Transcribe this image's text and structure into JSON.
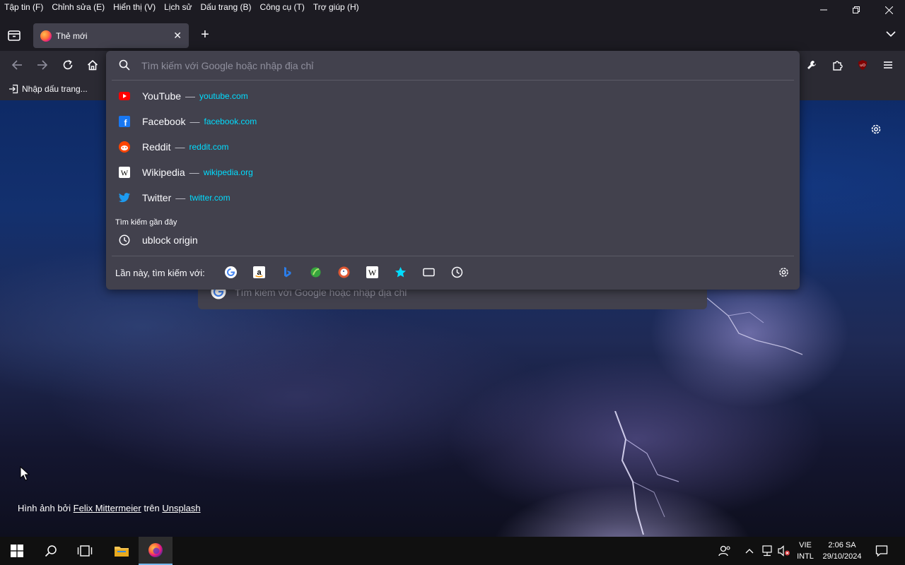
{
  "menubar": {
    "items": [
      "Tập tin (F)",
      "Chỉnh sửa (E)",
      "Hiển thị (V)",
      "Lịch sử",
      "Dấu trang (B)",
      "Công cụ (T)",
      "Trợ giúp (H)"
    ]
  },
  "tab": {
    "title": "Thẻ mới"
  },
  "bookmarks": {
    "import_label": "Nhập dấu trang..."
  },
  "urlbar": {
    "placeholder": "Tìm kiếm với Google hoặc nhập địa chỉ",
    "suggestions": [
      {
        "title": "YouTube",
        "url": "youtube.com"
      },
      {
        "title": "Facebook",
        "url": "facebook.com"
      },
      {
        "title": "Reddit",
        "url": "reddit.com"
      },
      {
        "title": "Wikipedia",
        "url": "wikipedia.org"
      },
      {
        "title": "Twitter",
        "url": "twitter.com"
      }
    ],
    "recent_label": "Tìm kiếm gần đây",
    "recent": [
      {
        "text": "ublock origin"
      }
    ],
    "separator": "—",
    "oneoff_label": "Lần này, tìm kiếm với:",
    "oneoff_engines": [
      "google-icon",
      "amazon-icon",
      "bing-icon",
      "ecosia-icon",
      "duckduckgo-icon",
      "wikipedia-icon",
      "bookmarks-icon",
      "tabs-icon",
      "history-icon"
    ]
  },
  "newtab": {
    "search_placeholder": "Tìm kiếm với Google hoặc nhập địa chỉ",
    "credit": {
      "prefix": "Hình ảnh bởi",
      "author": "Felix Mittermeier",
      "mid": "trên",
      "site": "Unsplash"
    }
  },
  "taskbar": {
    "lang_top": "VIE",
    "lang_bottom": "INTL",
    "time": "2:06 SA",
    "date": "29/10/2024"
  },
  "colors": {
    "chrome_bg": "#1c1b22",
    "toolbar_bg": "#2b2a33",
    "dropdown_bg": "#42414d",
    "url_accent": "#00ddff",
    "taskbar_bg": "#101010"
  }
}
